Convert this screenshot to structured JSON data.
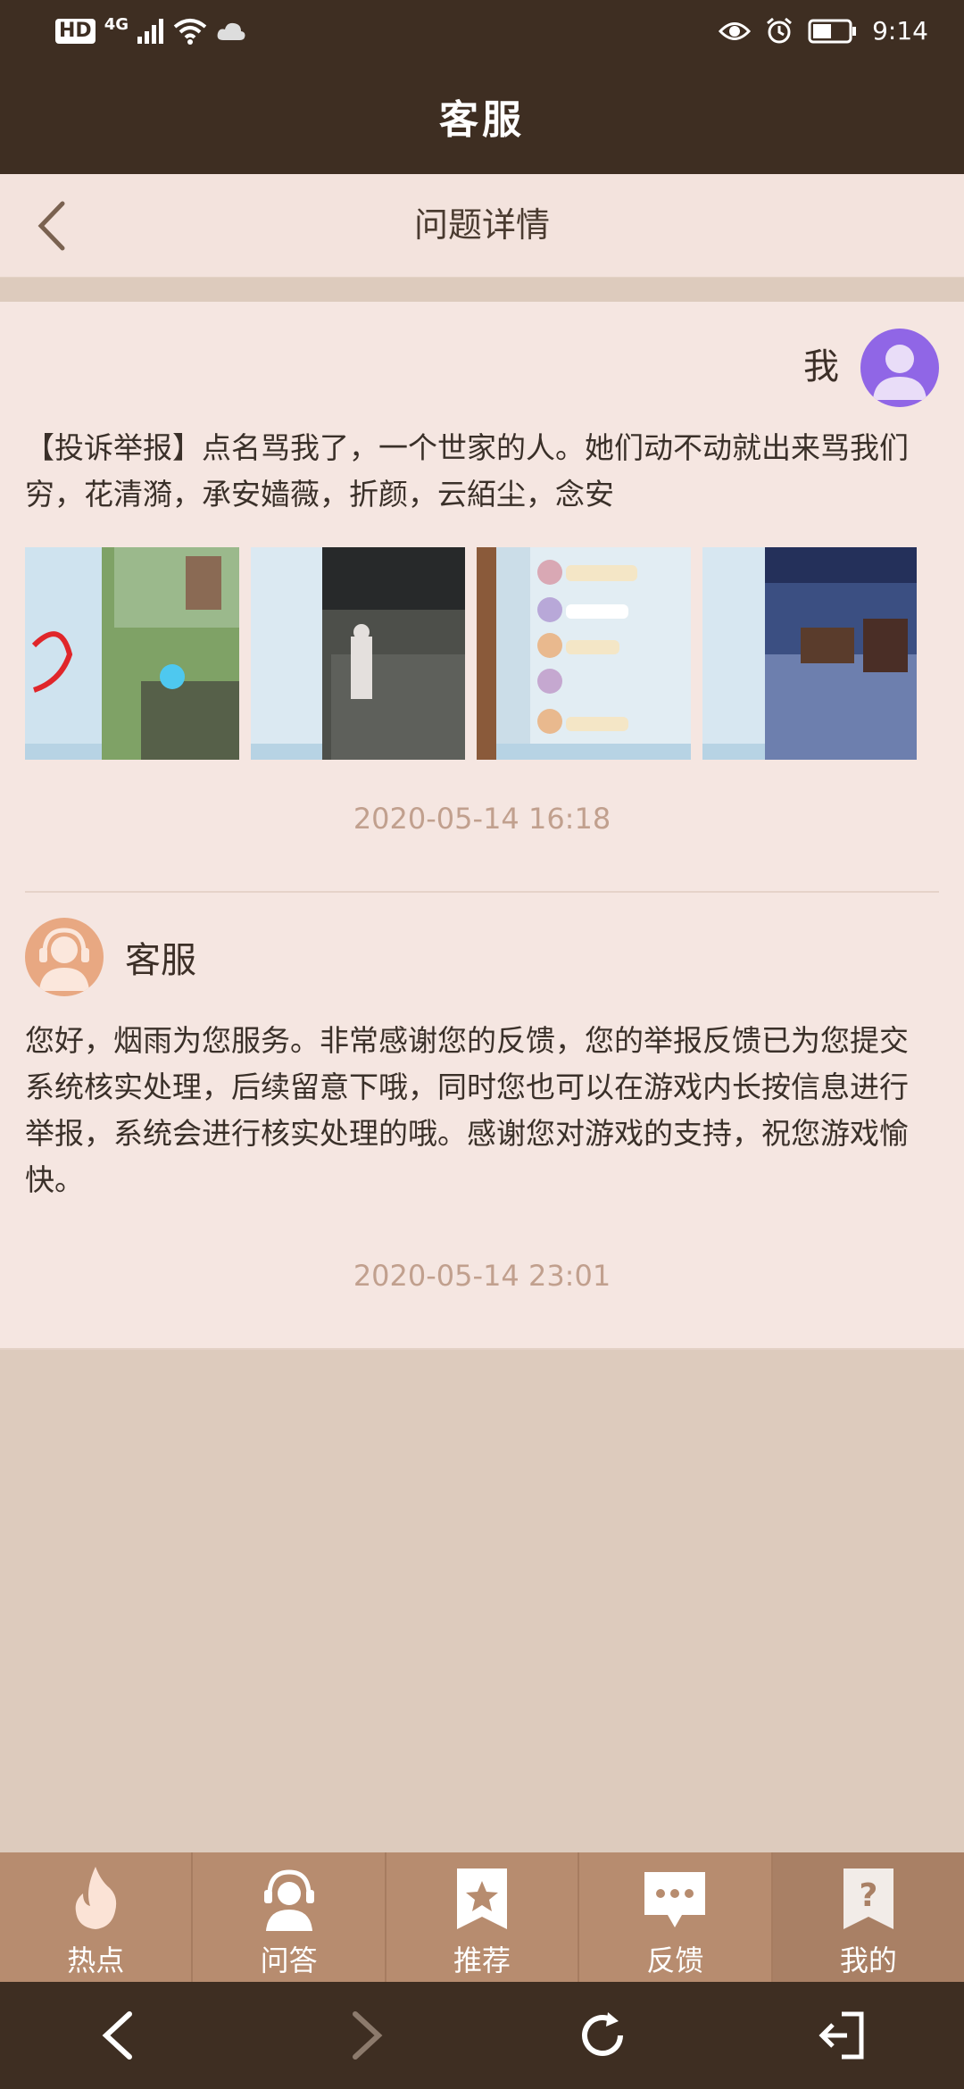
{
  "status_bar": {
    "network_hd": "HD",
    "network_type": "4G",
    "time": "9:14"
  },
  "app": {
    "title": "客服"
  },
  "header": {
    "title": "问题详情"
  },
  "question": {
    "author": "我",
    "text": "【投诉举报】点名骂我了，一个世家的人。她们动不动就出来骂我们穷，花清漪，承安嫱薇，折颜，云絔尘，念安",
    "timestamp": "2020-05-14 16:18",
    "attachments": [
      {
        "name": "screenshot-1"
      },
      {
        "name": "screenshot-2"
      },
      {
        "name": "screenshot-3"
      },
      {
        "name": "screenshot-4"
      }
    ]
  },
  "reply": {
    "author": "客服",
    "text": "您好，烟雨为您服务。非常感谢您的反馈，您的举报反馈已为您提交系统核实处理，后续留意下哦，同时您也可以在游戏内长按信息进行举报，系统会进行核实处理的哦。感谢您对游戏的支持，祝您游戏愉快。",
    "timestamp": "2020-05-14 23:01"
  },
  "tabs": [
    {
      "label": "热点",
      "icon": "flame-icon"
    },
    {
      "label": "问答",
      "icon": "headset-icon"
    },
    {
      "label": "推荐",
      "icon": "star-bookmark-icon"
    },
    {
      "label": "反馈",
      "icon": "chat-bubble-icon"
    },
    {
      "label": "我的",
      "icon": "question-icon",
      "selected": true
    }
  ],
  "colors": {
    "header_bg": "#3e2e22",
    "page_bg": "#ddcbbd",
    "card_bg": "#f5e6e1",
    "tab_bg": "#b78c6f",
    "timestamp": "#c1a08e"
  }
}
